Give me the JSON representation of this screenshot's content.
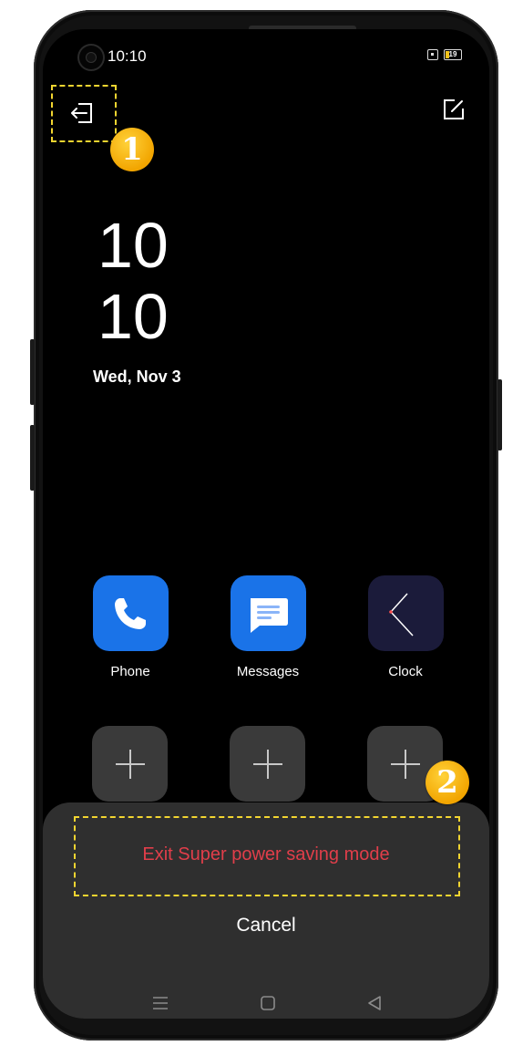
{
  "status_bar": {
    "time": "10:10",
    "battery_level": "19",
    "icons": [
      "camera-icon",
      "sim-icon",
      "battery-icon"
    ]
  },
  "top_actions": {
    "exit_icon": "exit-icon",
    "edit_icon": "edit-icon"
  },
  "clock": {
    "hour": "10",
    "minute": "10",
    "date": "Wed, Nov 3"
  },
  "apps": [
    {
      "label": "Phone",
      "icon": "phone-icon",
      "color": "#1a73e8"
    },
    {
      "label": "Messages",
      "icon": "message-icon",
      "color": "#1a73e8"
    },
    {
      "label": "Clock",
      "icon": "clock-icon",
      "color": "#1b1b3a"
    }
  ],
  "add_slots": [
    "plus-icon",
    "plus-icon",
    "plus-icon"
  ],
  "annotations": {
    "badge_1": "1",
    "badge_2": "2",
    "highlight_color": "#f2d530"
  },
  "sheet": {
    "exit_label": "Exit Super power saving mode",
    "exit_color": "#e13e4a",
    "cancel_label": "Cancel"
  },
  "nav_bar": [
    "menu-icon",
    "home-icon",
    "back-icon"
  ]
}
